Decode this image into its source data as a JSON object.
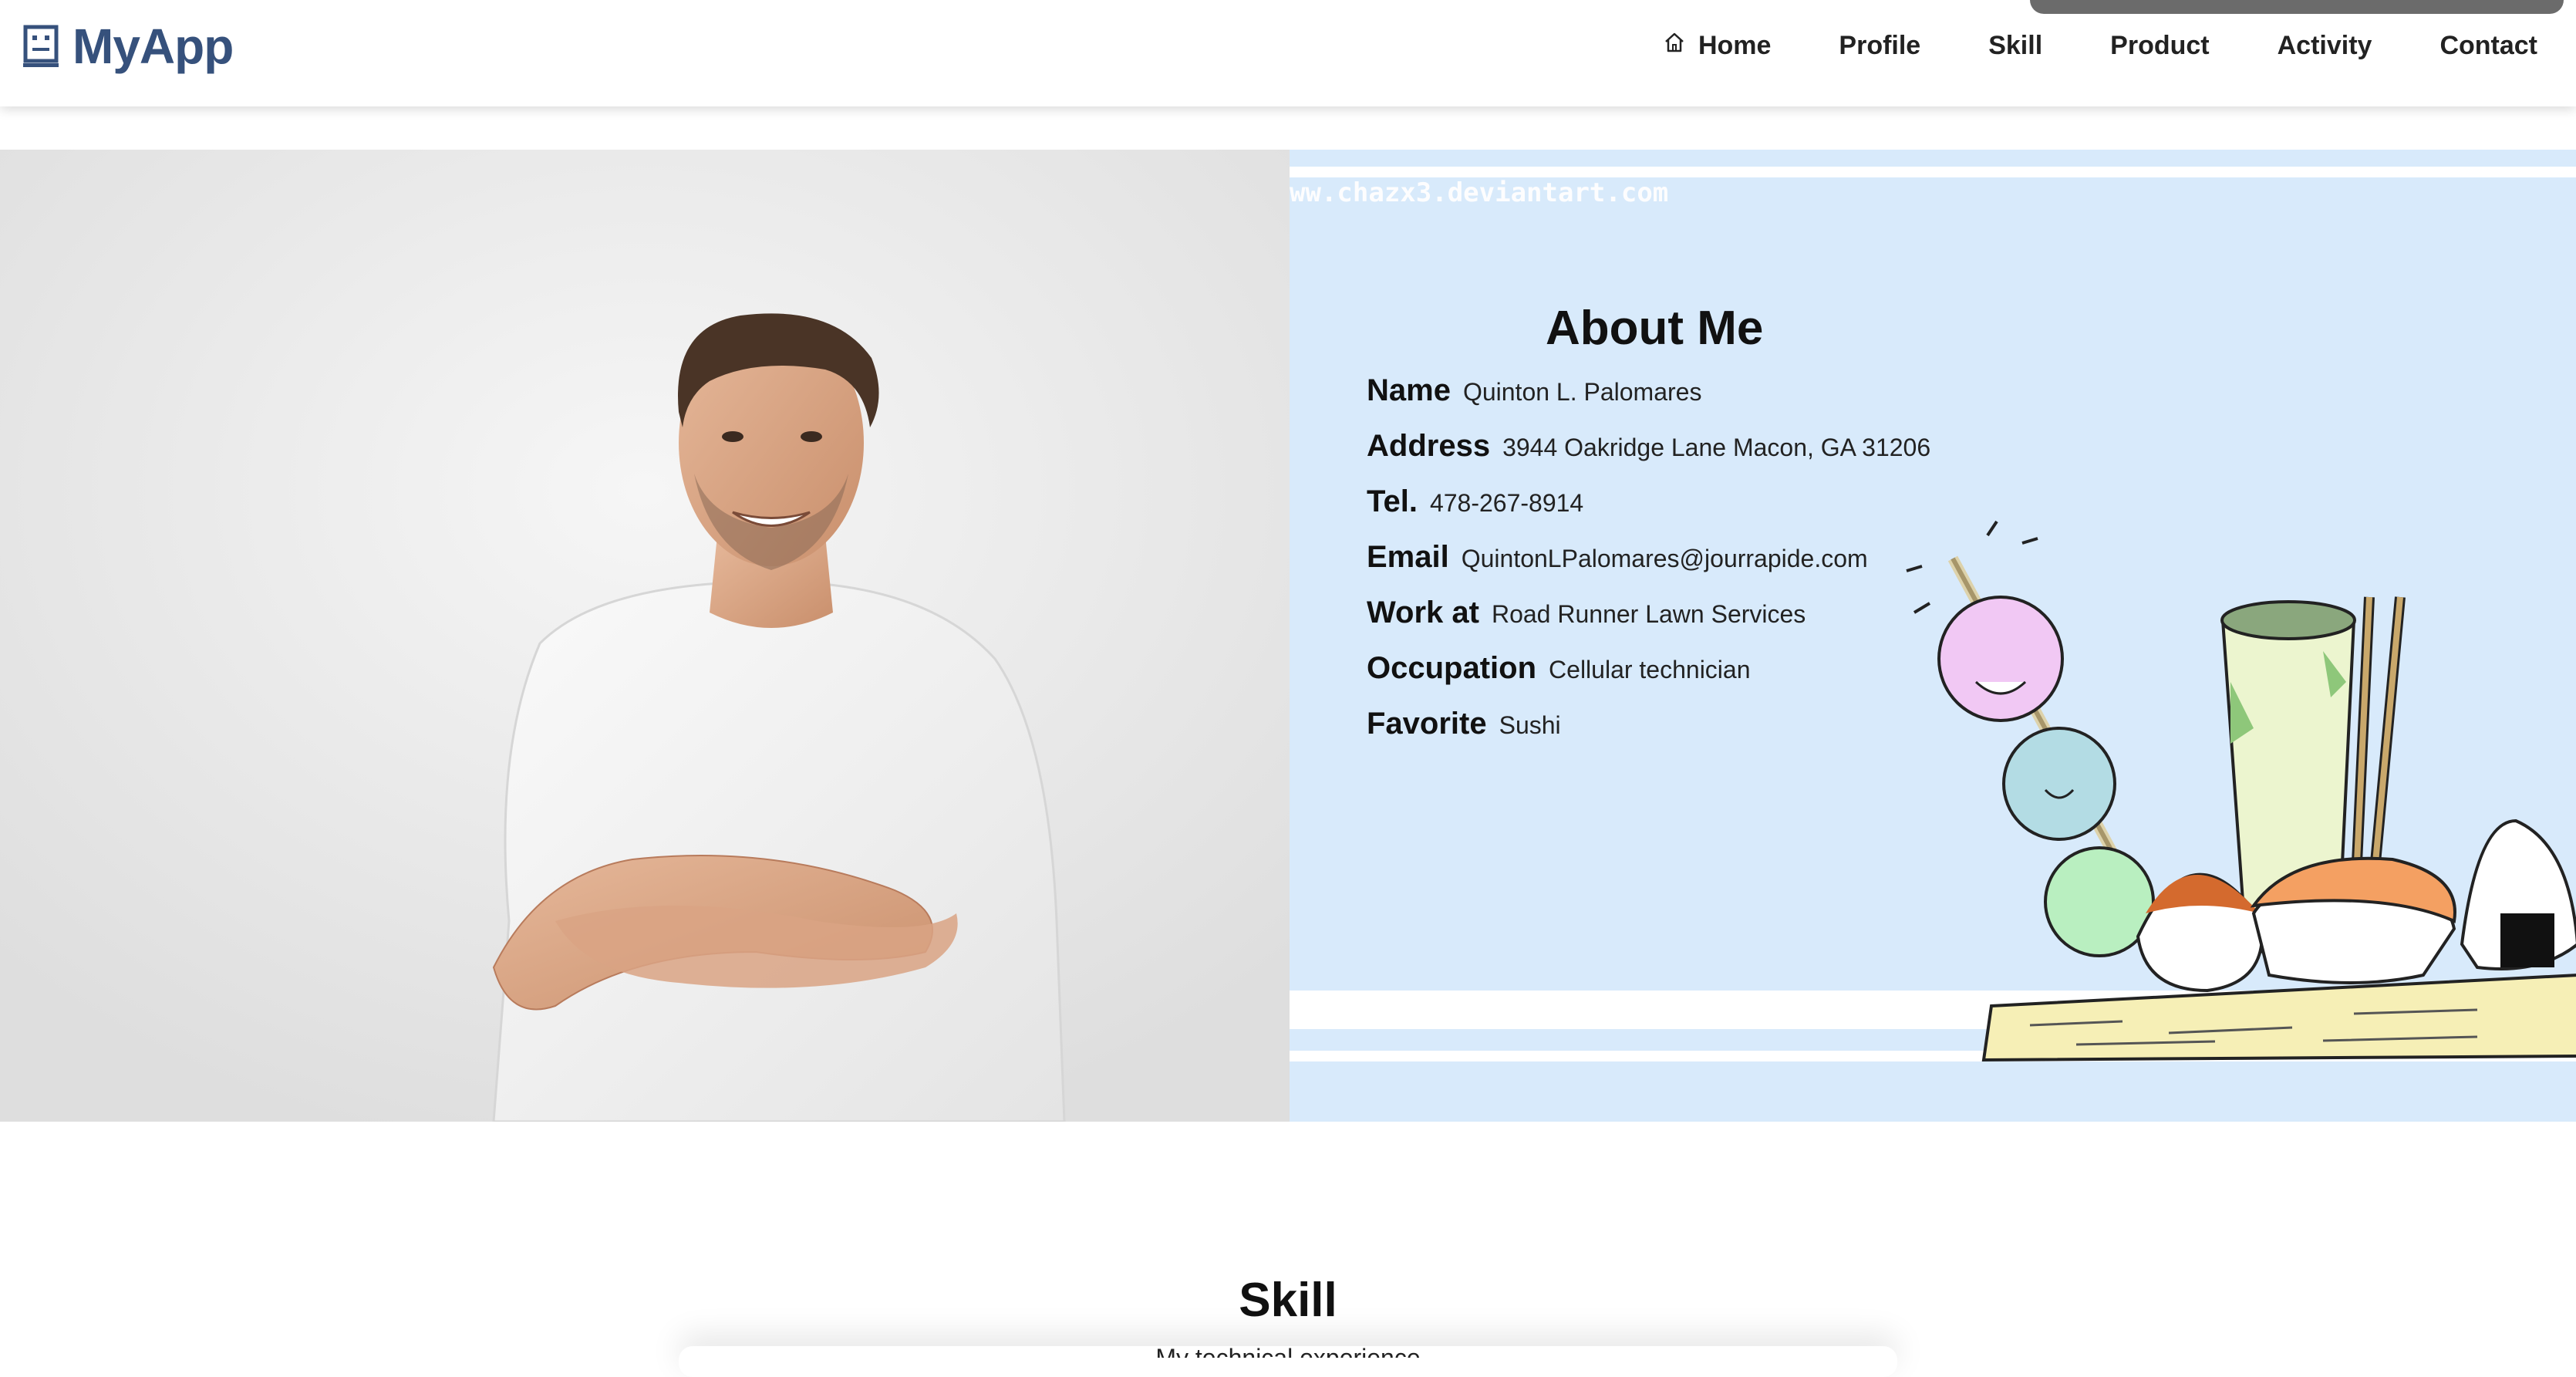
{
  "header": {
    "app_name": "MyApp",
    "nav": [
      "Home",
      "Profile",
      "Skill",
      "Product",
      "Activity",
      "Contact"
    ]
  },
  "about": {
    "watermark": "ww.chazx3.deviantart.com",
    "title": "About Me",
    "rows": [
      {
        "label": "Name",
        "value": "Quinton L. Palomares"
      },
      {
        "label": "Address",
        "value": "3944 Oakridge Lane Macon, GA 31206"
      },
      {
        "label": "Tel.",
        "value": "478-267-8914"
      },
      {
        "label": "Email",
        "value": "QuintonLPalomares@jourrapide.com"
      },
      {
        "label": "Work at",
        "value": "Road Runner Lawn Services"
      },
      {
        "label": "Occupation",
        "value": "Cellular technician"
      },
      {
        "label": "Favorite",
        "value": "Sushi"
      }
    ]
  },
  "skill": {
    "title": "Skill",
    "subtitle": "My technical experience"
  },
  "colors": {
    "brand": "#36517c",
    "panel": "#d8eafb"
  },
  "icons": [
    "app-logo-icon",
    "home-icon"
  ]
}
